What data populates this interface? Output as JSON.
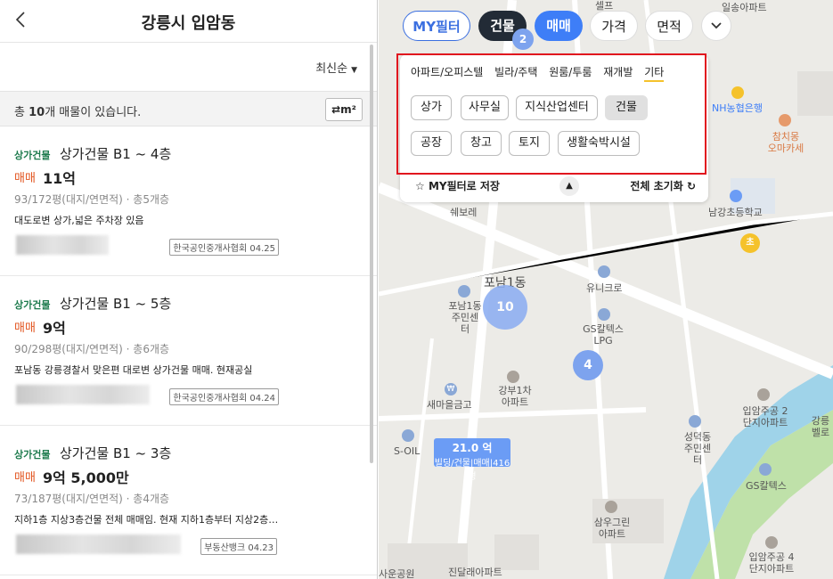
{
  "header": {
    "title": "강릉시 입암동",
    "back_icon": "chevron-left-icon"
  },
  "sort": {
    "label": "최신순"
  },
  "count": {
    "prefix": "총 ",
    "num": "10",
    "suffix": "개 매물이 있습니다."
  },
  "unit_button": "m²",
  "listings": [
    {
      "type": "상가건물",
      "title": "상가건물 B1 ~ 4층",
      "deal": "매매",
      "price": "11억",
      "area": "93/172평(대지/연면적) · 총5개층",
      "desc": "대도로변 상가,넓은 주차장 있음",
      "agency": "한국공인중개사협회 04.25"
    },
    {
      "type": "상가건물",
      "title": "상가건물 B1 ~ 5층",
      "deal": "매매",
      "price": "9억",
      "area": "90/298평(대지/연면적) · 총6개층",
      "desc": "포남동 강릉경찰서 맞은편 대로변 상가건물 매매. 현재공실",
      "agency": "한국공인중개사협회 04.24"
    },
    {
      "type": "상가건물",
      "title": "상가건물 B1 ~ 3층",
      "deal": "매매",
      "price": "9억 5,000만",
      "area": "73/187평(대지/연면적) · 총4개층",
      "desc": "지하1층 지상3층건물 전체 매매임. 현재 지하1층부터 지상2층…",
      "agency": "부동산뱅크 04.23"
    }
  ],
  "map_toolbar": {
    "my_filter": "MY필터",
    "building": "건물",
    "deal": "매매",
    "price": "가격",
    "area": "면적"
  },
  "filter_panel": {
    "tabs": [
      "아파트/오피스텔",
      "빌라/주택",
      "원룸/투룸",
      "재개발",
      "기타"
    ],
    "active_tab": "기타",
    "chips": [
      "상가",
      "사무실",
      "지식산업센터",
      "건물",
      "공장",
      "창고",
      "토지",
      "생활숙박시설"
    ],
    "selected_chip": "건물",
    "save_label": "MY필터로 저장",
    "reset_label": "전체 초기화"
  },
  "map_labels": {
    "selp": "셀프",
    "ilsong": "일송아파트",
    "nh": "NH농협은행",
    "chamchi": "참치몽 오마카세",
    "shebore": "쉐보레",
    "namgang": "남강초등학교",
    "cho": "초",
    "ponam1": "포남1동",
    "ponam_center": "포남1동 주민센터",
    "unigreen": "유니크로",
    "gscaltex_lpg": "GS칼텍스 LPG",
    "gangbu": "강부1차 아파트",
    "saemaul": "새마을금고",
    "ipam2": "입암주공 2단지아파트",
    "seongdeok": "성덕동 주민센터",
    "soil": "S-OIL",
    "gscaltex": "GS칼텍스",
    "samwoo": "삼우그린 아파트",
    "ipam4": "입암주공 4단지아파트",
    "jindallae": "진달래아파트",
    "gangbel": "강릉 벨로",
    "saeun": "사운공원",
    "won_icon": "₩"
  },
  "clusters": {
    "c1": "2",
    "c2": "10",
    "c3": "4"
  },
  "price_pin": {
    "price": "21.0 억",
    "sub": "빌딩/건물|매매|416평"
  },
  "colors": {
    "accent": "#3e7ef7",
    "deal_red": "#e2541f",
    "type_green": "#1c7a4c",
    "highlight": "#e1141e"
  }
}
